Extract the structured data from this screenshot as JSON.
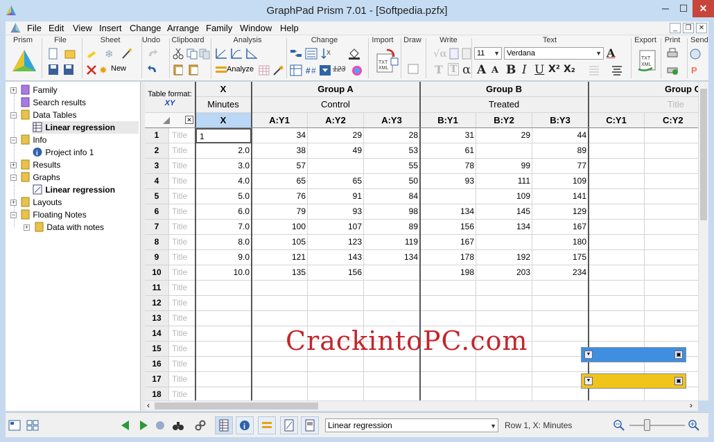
{
  "window": {
    "title": "GraphPad Prism 7.01 - [Softpedia.pzfx]"
  },
  "window_controls": {
    "minimize": "─",
    "maximize": "☐",
    "close": "✕"
  },
  "menu": [
    "File",
    "Edit",
    "View",
    "Insert",
    "Change",
    "Arrange",
    "Family",
    "Window",
    "Help"
  ],
  "mdi_controls": {
    "minimize": "_",
    "restore": "❐",
    "close": "✕"
  },
  "toolbar": {
    "groups": [
      "Prism",
      "File",
      "Sheet",
      "Undo",
      "Clipboard",
      "Analysis",
      "Change",
      "Import",
      "Draw",
      "Write",
      "Text",
      "Export",
      "Print",
      "Send"
    ],
    "new_label": "New",
    "analyze_label": "Analyze",
    "font_size": "11",
    "font_name": "Verdana",
    "text_buttons": {
      "bold": "B",
      "italic": "I",
      "underline": "U",
      "superscript": "X²",
      "subscript": "X₂",
      "alpha": "α",
      "grow": "A",
      "shrink": "A",
      "t1": "T",
      "t2": "T",
      "n123": "123"
    }
  },
  "navigator": {
    "items": [
      {
        "label": "Family",
        "bold": false,
        "selected": false
      },
      {
        "label": "Search results",
        "bold": false,
        "selected": false
      },
      {
        "label": "Data Tables",
        "bold": false,
        "selected": false
      },
      {
        "label": "Linear regression",
        "bold": true,
        "selected": true
      },
      {
        "label": "Info",
        "bold": false,
        "selected": false
      },
      {
        "label": "Project info 1",
        "bold": false,
        "selected": false
      },
      {
        "label": "Results",
        "bold": false,
        "selected": false
      },
      {
        "label": "Graphs",
        "bold": false,
        "selected": false
      },
      {
        "label": "Linear regression",
        "bold": true,
        "selected": false
      },
      {
        "label": "Layouts",
        "bold": false,
        "selected": false
      },
      {
        "label": "Floating Notes",
        "bold": false,
        "selected": false
      },
      {
        "label": "Data with notes",
        "bold": false,
        "selected": false
      }
    ]
  },
  "sheet": {
    "table_format_label": "Table format:",
    "table_format_value": "XY",
    "close_glyph": "✕",
    "groups": [
      {
        "header": "X",
        "subtitle": "Minutes",
        "columns": [
          "X"
        ]
      },
      {
        "header": "Group A",
        "subtitle": "Control",
        "columns": [
          "A:Y1",
          "A:Y2",
          "A:Y3"
        ]
      },
      {
        "header": "Group B",
        "subtitle": "Treated",
        "columns": [
          "B:Y1",
          "B:Y2",
          "B:Y3"
        ]
      },
      {
        "header": "Group C",
        "subtitle": "Title",
        "columns": [
          "C:Y1",
          "C:Y2"
        ]
      }
    ],
    "row_title_placeholder": "Title",
    "rows": [
      {
        "n": "1",
        "x": "1",
        "a1": "34",
        "a2": "29",
        "a3": "28",
        "b1": "31",
        "b2": "29",
        "b3": "44"
      },
      {
        "n": "2",
        "x": "2.0",
        "a1": "38",
        "a2": "49",
        "a3": "53",
        "b1": "61",
        "b2": "",
        "b3": "89"
      },
      {
        "n": "3",
        "x": "3.0",
        "a1": "57",
        "a2": "",
        "a3": "55",
        "b1": "78",
        "b2": "99",
        "b3": "77"
      },
      {
        "n": "4",
        "x": "4.0",
        "a1": "65",
        "a2": "65",
        "a3": "50",
        "b1": "93",
        "b2": "111",
        "b3": "109"
      },
      {
        "n": "5",
        "x": "5.0",
        "a1": "76",
        "a2": "91",
        "a3": "84",
        "b1": "",
        "b2": "109",
        "b3": "141"
      },
      {
        "n": "6",
        "x": "6.0",
        "a1": "79",
        "a2": "93",
        "a3": "98",
        "b1": "134",
        "b2": "145",
        "b3": "129"
      },
      {
        "n": "7",
        "x": "7.0",
        "a1": "100",
        "a2": "107",
        "a3": "89",
        "b1": "156",
        "b2": "134",
        "b3": "167"
      },
      {
        "n": "8",
        "x": "8.0",
        "a1": "105",
        "a2": "123",
        "a3": "119",
        "b1": "167",
        "b2": "",
        "b3": "180"
      },
      {
        "n": "9",
        "x": "9.0",
        "a1": "121",
        "a2": "143",
        "a3": "134",
        "b1": "178",
        "b2": "192",
        "b3": "175"
      },
      {
        "n": "10",
        "x": "10.0",
        "a1": "135",
        "a2": "156",
        "a3": "",
        "b1": "198",
        "b2": "203",
        "b3": "234"
      },
      {
        "n": "11",
        "x": "",
        "a1": "",
        "a2": "",
        "a3": "",
        "b1": "",
        "b2": "",
        "b3": ""
      },
      {
        "n": "12",
        "x": "",
        "a1": "",
        "a2": "",
        "a3": "",
        "b1": "",
        "b2": "",
        "b3": ""
      },
      {
        "n": "13",
        "x": "",
        "a1": "",
        "a2": "",
        "a3": "",
        "b1": "",
        "b2": "",
        "b3": ""
      },
      {
        "n": "14",
        "x": "",
        "a1": "",
        "a2": "",
        "a3": "",
        "b1": "",
        "b2": "",
        "b3": ""
      },
      {
        "n": "15",
        "x": "",
        "a1": "",
        "a2": "",
        "a3": "",
        "b1": "",
        "b2": "",
        "b3": ""
      },
      {
        "n": "16",
        "x": "",
        "a1": "",
        "a2": "",
        "a3": "",
        "b1": "",
        "b2": "",
        "b3": ""
      },
      {
        "n": "17",
        "x": "",
        "a1": "",
        "a2": "",
        "a3": "",
        "b1": "",
        "b2": "",
        "b3": ""
      },
      {
        "n": "18",
        "x": "",
        "a1": "",
        "a2": "",
        "a3": "",
        "b1": "",
        "b2": "",
        "b3": ""
      }
    ]
  },
  "watermark": "CrackintoPC.com",
  "floating_notes": {
    "colors": [
      "#3f8fe0",
      "#f0c419"
    ]
  },
  "statusbar": {
    "sheet_select": "Linear regression",
    "position": "Row 1, X: Minutes"
  },
  "colors": {
    "selection": "#bad7f5",
    "accent": "#3f6fb5",
    "close": "#c7453a"
  }
}
